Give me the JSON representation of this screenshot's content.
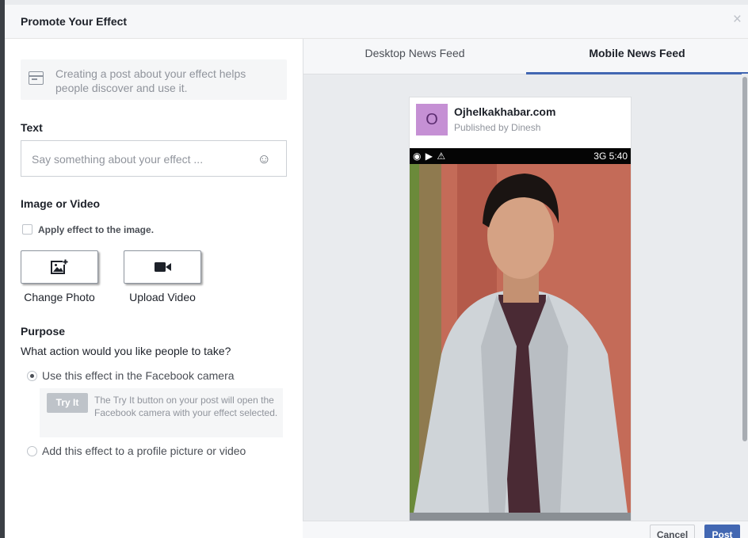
{
  "dialog": {
    "title": "Promote Your Effect",
    "close_glyph": "×"
  },
  "info": {
    "icon": "layout-card-icon",
    "text": "Creating a post about your effect helps people discover and use it."
  },
  "text_section": {
    "label": "Text",
    "placeholder": "Say something about your effect ...",
    "value": "",
    "emoji_icon": "smiley-icon",
    "emoji_glyph": "☺"
  },
  "media_section": {
    "label": "Image or Video",
    "apply_checkbox_label": "Apply effect to the image.",
    "apply_checked": false,
    "change_photo_label": "Change Photo",
    "upload_video_label": "Upload Video"
  },
  "purpose": {
    "label": "Purpose",
    "question": "What action would you like people to take?",
    "options": [
      {
        "label": "Use this effect in the Facebook camera",
        "selected": true
      },
      {
        "label": "Add this effect to a profile picture or video",
        "selected": false
      }
    ],
    "try_it_label": "Try It",
    "try_it_desc": "The Try It button on your post will open the Facebook camera with your effect selected."
  },
  "preview_tabs": {
    "desktop": "Desktop News Feed",
    "mobile": "Mobile News Feed",
    "active": "mobile"
  },
  "preview_post": {
    "avatar_letter": "O",
    "page_name": "Ojhelkakhabar.com",
    "published_by": "Published by Dinesh",
    "status_left": "◉ ▶ ⚠",
    "status_right": "3G 5:40",
    "colors": {
      "avatar_bg": "#c590d4",
      "wall": "#c46b58",
      "jacket": "#cfd4d8"
    }
  },
  "footer": {
    "cancel_label": "Cancel",
    "post_label": "Post"
  }
}
